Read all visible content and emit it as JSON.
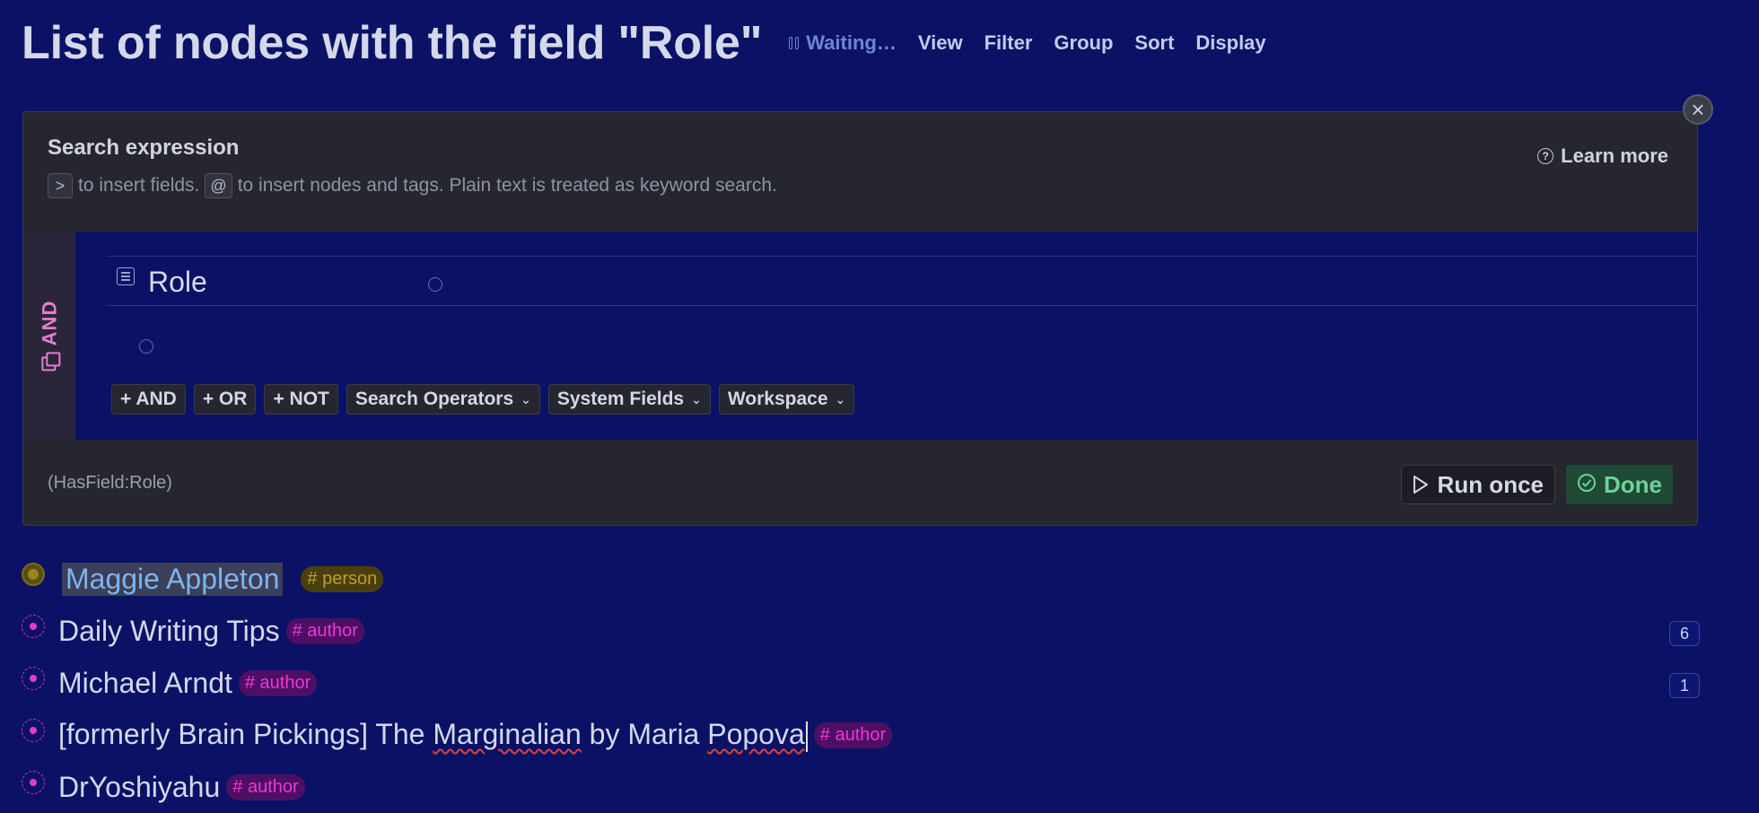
{
  "header": {
    "title": "List of nodes with the field \"Role\"",
    "status": "Waiting…",
    "toolbar": [
      "View",
      "Filter",
      "Group",
      "Sort",
      "Display"
    ]
  },
  "search_panel": {
    "title": "Search expression",
    "hint_key_1": ">",
    "hint_text_1": "to insert fields.",
    "hint_key_2": "@",
    "hint_text_2": "to insert nodes and tags. Plain text is treated as keyword search.",
    "learn_more": "Learn more",
    "and_label": "AND",
    "field_name": "Role",
    "buttons": {
      "add_and": "+ AND",
      "add_or": "+ OR",
      "add_not": "+ NOT",
      "search_operators": "Search Operators",
      "system_fields": "System Fields",
      "workspace": "Workspace"
    },
    "query": "(HasField:Role)",
    "run_once": "Run once",
    "done": "Done"
  },
  "results": [
    {
      "name": "Maggie Appleton",
      "tag": "# person",
      "count": ""
    },
    {
      "name": "Daily Writing Tips",
      "tag": "# author",
      "count": "6"
    },
    {
      "name": "Michael Arndt",
      "tag": "# author",
      "count": "1"
    },
    {
      "name_part1": "[formerly Brain Pickings] The ",
      "name_part2": "Marginalian",
      "name_part3": " by Maria ",
      "name_part4": "Popova",
      "tag": "# author",
      "count": ""
    },
    {
      "name": "DrYoshiyahu",
      "tag": "# author",
      "count": ""
    }
  ],
  "colors": {
    "background": "#0b1266",
    "panel": "#26262f",
    "author_tag": "#ef35d6",
    "person_tag": "#b8a034",
    "done_green": "#6ad39a"
  }
}
